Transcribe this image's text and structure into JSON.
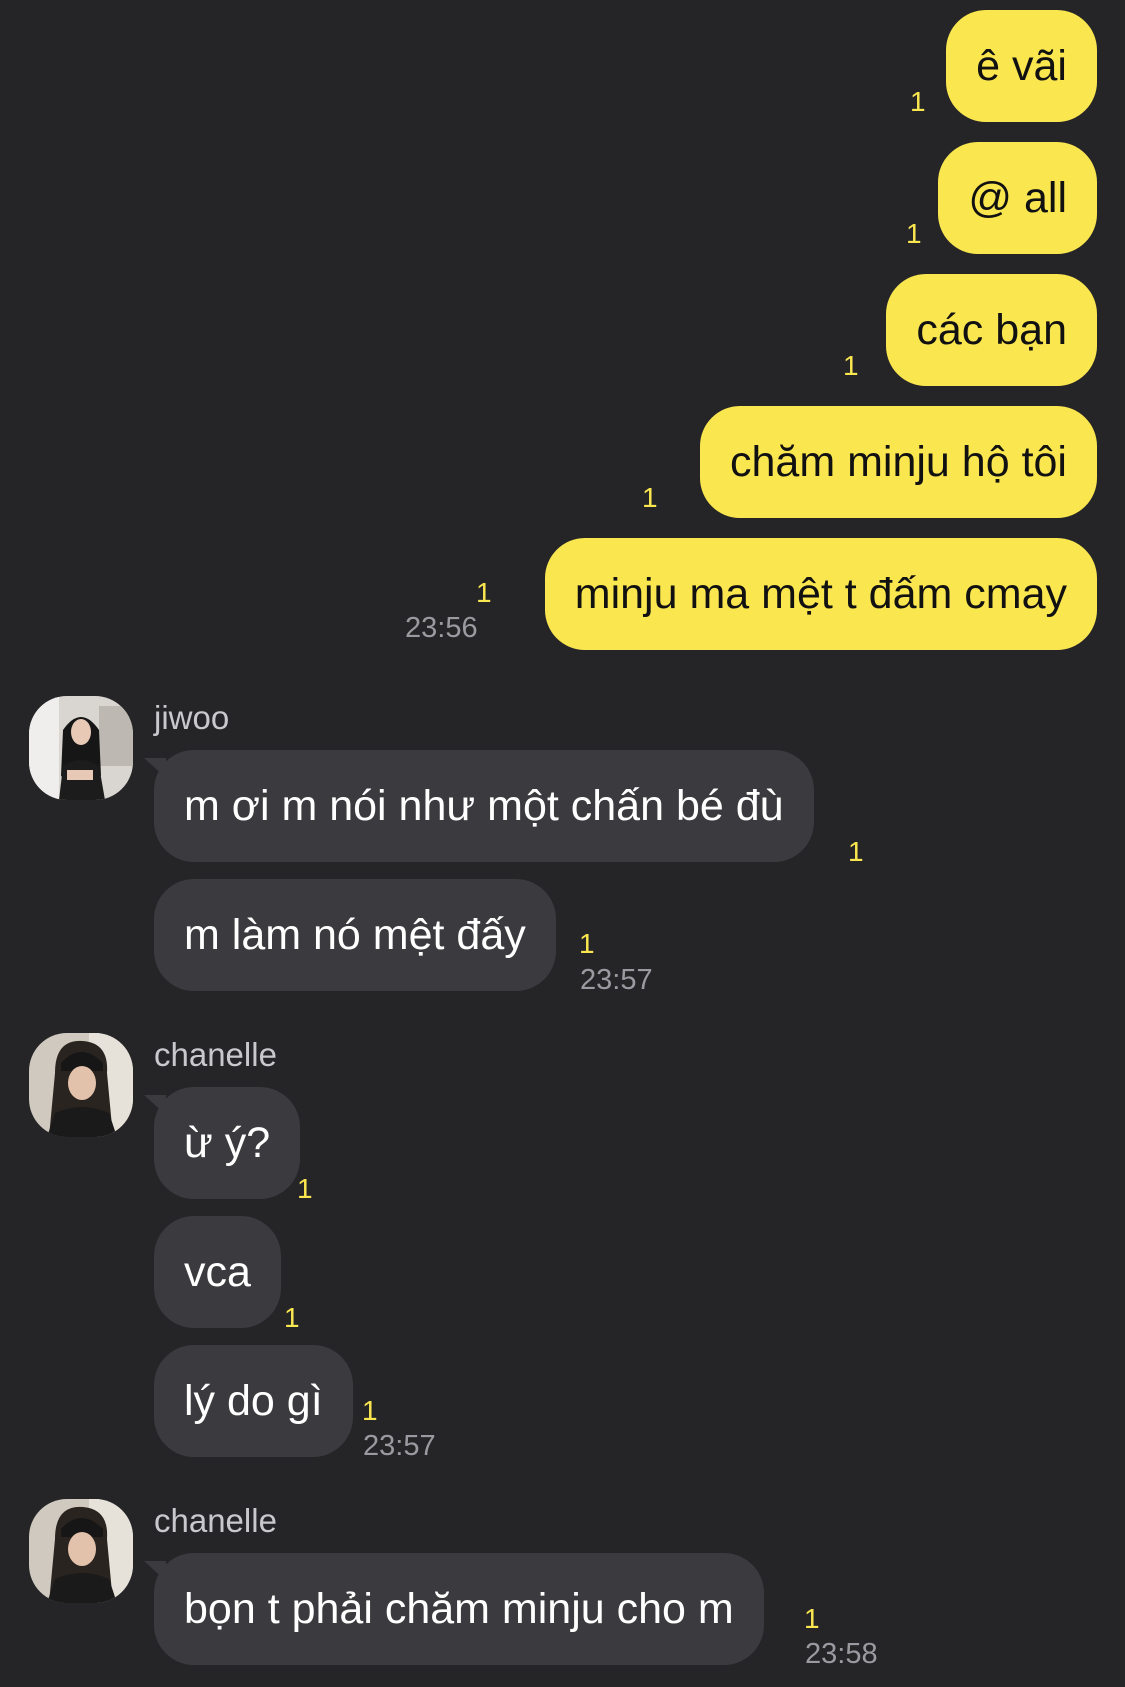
{
  "outgoing": [
    {
      "text": "ê vãi",
      "unread": "1"
    },
    {
      "text": "@ all",
      "unread": "1"
    },
    {
      "text": "các bạn",
      "unread": "1"
    },
    {
      "text": "chăm minju hộ tôi",
      "unread": "1"
    },
    {
      "text": "minju ma mệt t đấm cmay",
      "unread": "1",
      "time": "23:56"
    }
  ],
  "groups": [
    {
      "sender": "jiwoo",
      "avatar_icon": "profile-photo",
      "messages": [
        {
          "text": "m ơi m nói như một chấn bé đù",
          "unread": "1"
        },
        {
          "text": "m làm nó mệt đấy",
          "unread": "1",
          "time": "23:57"
        }
      ]
    },
    {
      "sender": "chanelle",
      "avatar_icon": "profile-photo",
      "messages": [
        {
          "text": "ừ ý?",
          "unread": "1"
        },
        {
          "text": "vca",
          "unread": "1"
        },
        {
          "text": "lý do gì",
          "unread": "1",
          "time": "23:57"
        }
      ]
    },
    {
      "sender": "chanelle",
      "avatar_icon": "profile-photo",
      "messages": [
        {
          "text": "bọn t phải chăm minju cho m",
          "unread": "1",
          "time": "23:58"
        }
      ]
    }
  ],
  "colors": {
    "background": "#252528",
    "outgoing_bubble": "#fae64f",
    "incoming_bubble": "#3b3b3f",
    "unread_count": "#fae64f",
    "timestamp": "#9a9aa0"
  }
}
